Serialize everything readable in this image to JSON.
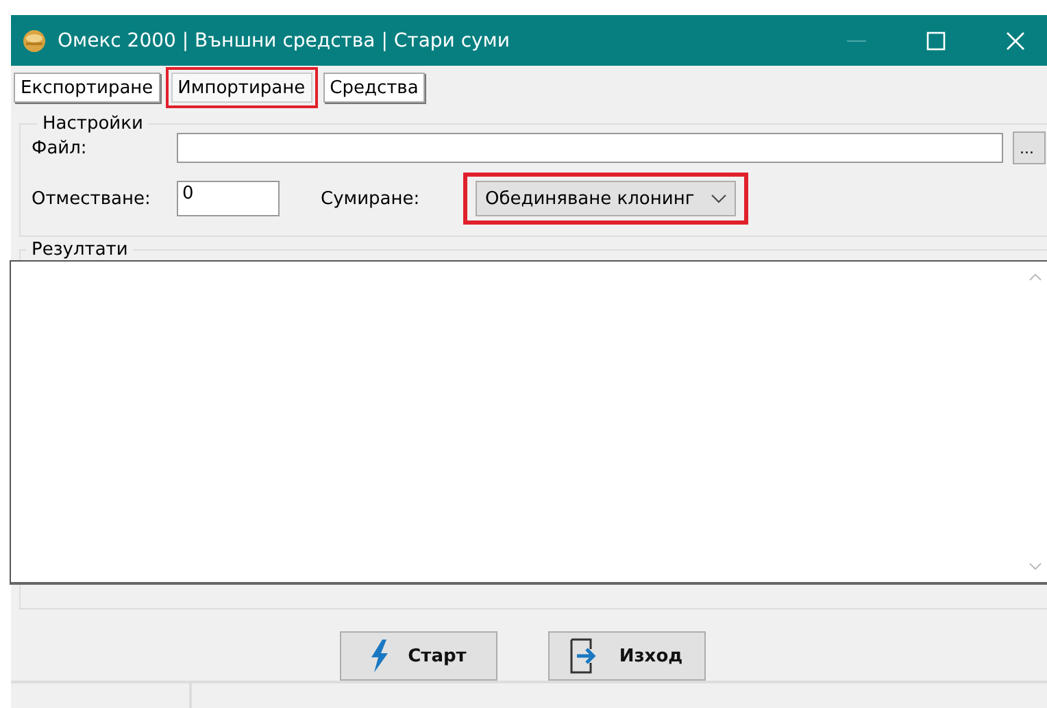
{
  "window": {
    "title": "Омекс 2000 | Външни средства | Стари суми"
  },
  "tabs": [
    {
      "label": "Експортиране",
      "selected": false,
      "highlighted": false
    },
    {
      "label": "Импортиране",
      "selected": true,
      "highlighted": true
    },
    {
      "label": "Средства",
      "selected": false,
      "highlighted": false
    }
  ],
  "settings": {
    "title": "Настройки",
    "file_label": "Файл:",
    "browse_button": "...",
    "offset_label": "Отместване:",
    "offset_value": "0",
    "sum_label": "Сумиране:",
    "sum_value": "Обединяване клонинг",
    "sum_highlighted": true
  },
  "results": {
    "title": "Резултати"
  },
  "buttons": [
    {
      "label": "Старт",
      "kind": "start"
    },
    {
      "label": "Изход",
      "kind": "exit"
    }
  ]
}
